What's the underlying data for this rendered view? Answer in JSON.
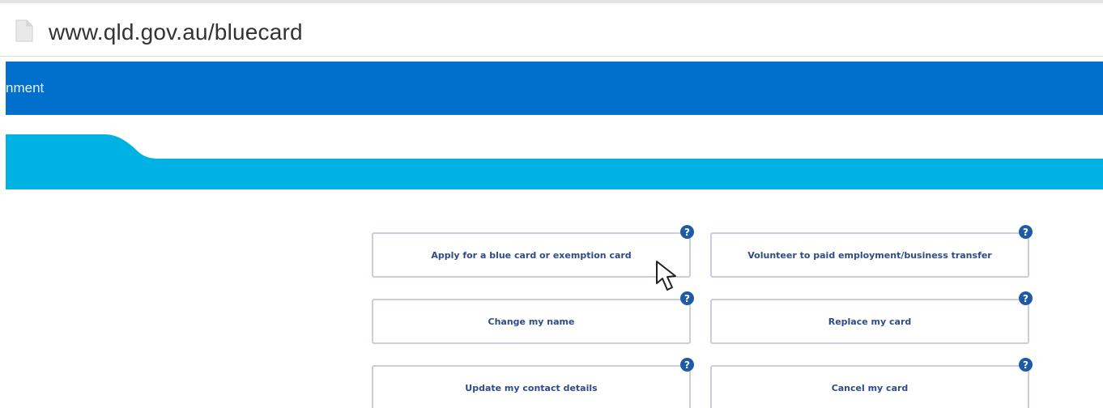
{
  "browser": {
    "url": "www.qld.gov.au/bluecard",
    "page_icon": "document-icon"
  },
  "header": {
    "partial_text": "nment",
    "background": "#0070cc"
  },
  "ribbon": {
    "color": "#00b2e3"
  },
  "cards": [
    {
      "label": "Apply for a blue card or exemption card",
      "help": "?"
    },
    {
      "label": "Volunteer to paid employment/business transfer",
      "help": "?"
    },
    {
      "label": "Change my name",
      "help": "?"
    },
    {
      "label": "Replace my card",
      "help": "?"
    },
    {
      "label": "Update my contact details",
      "help": "?"
    },
    {
      "label": "Cancel my card",
      "help": "?"
    }
  ],
  "colors": {
    "card_text": "#2e4a8a",
    "card_border": "#c9cde0",
    "help_badge": "#1f5aa6"
  }
}
